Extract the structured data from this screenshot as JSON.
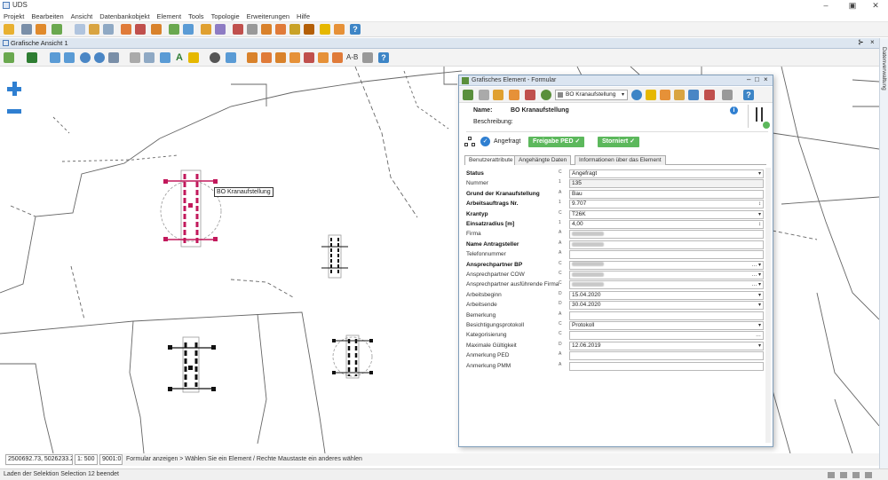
{
  "window": {
    "title": "UDS"
  },
  "menu": [
    "Projekt",
    "Bearbeiten",
    "Ansicht",
    "Datenbankobjekt",
    "Element",
    "Tools",
    "Topologie",
    "Erweiterungen",
    "Hilfe"
  ],
  "view_tab": {
    "label": "Grafische Ansicht 1"
  },
  "right_panel": {
    "label": "Datenverwaltung"
  },
  "map": {
    "selected_label": "BO Kranaufstellung"
  },
  "form": {
    "title": "Grafisches Element - Formular",
    "type_dropdown": "BO Kranaufstellung",
    "name_label": "Name:",
    "name_value": "BO Kranaufstellung",
    "desc_label": "Beschreibung:",
    "status_text": "Angefragt",
    "btn_freigabe": "Freigabe PED",
    "btn_storniert": "Storniert",
    "tabs": [
      "Benutzerattribute",
      "Angehängte Daten",
      "Informationen über das Element"
    ],
    "rows": [
      {
        "label": "Status",
        "bold": true,
        "type": "C",
        "value": "Angefragt",
        "dd": "▾",
        "dis": false
      },
      {
        "label": "Nummer",
        "bold": false,
        "type": "1",
        "value": "135",
        "dd": "",
        "dis": true
      },
      {
        "label": "Grund der Kranaufstellung",
        "bold": true,
        "type": "A",
        "value": "Bau",
        "dd": "",
        "dis": false
      },
      {
        "label": "Arbeitsauftrags Nr.",
        "bold": true,
        "type": "1",
        "value": "9.707",
        "dd": "↕",
        "dis": false
      },
      {
        "label": "Krantyp",
        "bold": true,
        "type": "C",
        "value": "T26K",
        "dd": "▾",
        "dis": false
      },
      {
        "label": "Einsatzradius [m]",
        "bold": true,
        "type": "1",
        "value": "4,00",
        "dd": "↕",
        "dis": false
      },
      {
        "label": "Firma",
        "bold": false,
        "type": "A",
        "value": "",
        "dd": "",
        "dis": false,
        "blur": true
      },
      {
        "label": "Name Antragsteller",
        "bold": true,
        "type": "A",
        "value": "",
        "dd": "",
        "dis": false,
        "blur": true
      },
      {
        "label": "Telefonnummer",
        "bold": false,
        "type": "A",
        "value": "",
        "dd": "",
        "dis": false
      },
      {
        "label": "Ansprechpartner BP",
        "bold": true,
        "type": "C",
        "value": "",
        "dd": "… ▾",
        "dis": false,
        "blur": true
      },
      {
        "label": "Ansprechpartner COW",
        "bold": false,
        "type": "C",
        "value": "",
        "dd": "… ▾",
        "dis": false,
        "blur": true
      },
      {
        "label": "Ansprechpartner ausführende Firma",
        "bold": false,
        "type": "C",
        "value": "",
        "dd": "… ▾",
        "dis": false,
        "blur": true
      },
      {
        "label": "Arbeitsbeginn",
        "bold": false,
        "type": "D",
        "value": "15.04.2020",
        "dd": "▾",
        "dis": false
      },
      {
        "label": "Arbeitsende",
        "bold": false,
        "type": "D",
        "value": "30.04.2020",
        "dd": "▾",
        "dis": false
      },
      {
        "label": "Bemerkung",
        "bold": false,
        "type": "A",
        "value": "",
        "dd": "",
        "dis": false
      },
      {
        "label": "Besichtigungsprotokoll",
        "bold": false,
        "type": "C",
        "value": "Protokoll",
        "dd": "▾",
        "dis": false
      },
      {
        "label": "Kategorisierung",
        "bold": false,
        "type": "C",
        "value": "",
        "dd": "…",
        "dis": false
      },
      {
        "label": "Maximale Gültigkeit",
        "bold": false,
        "type": "D",
        "value": "12.06.2019",
        "dd": "▾",
        "dis": false
      },
      {
        "label": "Anmerkung PED",
        "bold": false,
        "type": "A",
        "value": "",
        "dd": "",
        "dis": false
      },
      {
        "label": "Anmerkung PMM",
        "bold": false,
        "type": "A",
        "value": "",
        "dd": "",
        "dis": false
      }
    ]
  },
  "coords": {
    "xy": "2500692.73, 5026233.24",
    "scale": "1: 500",
    "rot": "9001:0",
    "hint": "Formular anzeigen > Wählen Sie ein Element / Rechte Maustaste ein anderes wählen"
  },
  "status": {
    "text": "Laden der Selektion Selection 12 beendet"
  },
  "colors": {
    "accent": "#2f7fd1",
    "selected": "#c2185b",
    "green": "#5cb85c",
    "map_line": "#555555"
  }
}
